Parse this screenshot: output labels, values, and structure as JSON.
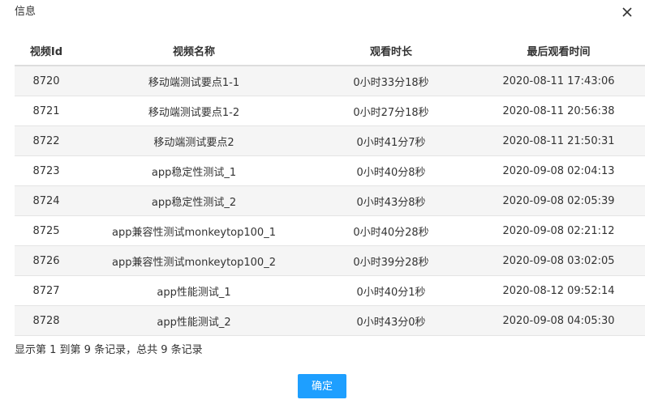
{
  "dialog": {
    "title": "信息",
    "close_icon": "close-icon"
  },
  "table": {
    "headers": {
      "video_id": "视频Id",
      "video_name": "视频名称",
      "watch_duration": "观看时长",
      "last_watch_time": "最后观看时间"
    },
    "rows": [
      {
        "video_id": "8720",
        "video_name": "移动端测试要点1-1",
        "watch_duration": "0小时33分18秒",
        "last_watch_time": "2020-08-11 17:43:06"
      },
      {
        "video_id": "8721",
        "video_name": "移动端测试要点1-2",
        "watch_duration": "0小时27分18秒",
        "last_watch_time": "2020-08-11 20:56:38"
      },
      {
        "video_id": "8722",
        "video_name": "移动端测试要点2",
        "watch_duration": "0小时41分7秒",
        "last_watch_time": "2020-08-11 21:50:31"
      },
      {
        "video_id": "8723",
        "video_name": "app稳定性测试_1",
        "watch_duration": "0小时40分8秒",
        "last_watch_time": "2020-09-08 02:04:13"
      },
      {
        "video_id": "8724",
        "video_name": "app稳定性测试_2",
        "watch_duration": "0小时43分8秒",
        "last_watch_time": "2020-09-08 02:05:39"
      },
      {
        "video_id": "8725",
        "video_name": "app兼容性测试monkeytop100_1",
        "watch_duration": "0小时40分28秒",
        "last_watch_time": "2020-09-08 02:21:12"
      },
      {
        "video_id": "8726",
        "video_name": "app兼容性测试monkeytop100_2",
        "watch_duration": "0小时39分28秒",
        "last_watch_time": "2020-09-08 03:02:05"
      },
      {
        "video_id": "8727",
        "video_name": "app性能测试_1",
        "watch_duration": "0小时40分1秒",
        "last_watch_time": "2020-08-12 09:52:14"
      },
      {
        "video_id": "8728",
        "video_name": "app性能测试_2",
        "watch_duration": "0小时43分0秒",
        "last_watch_time": "2020-09-08 04:05:30"
      }
    ]
  },
  "pagination": {
    "info": "显示第 1 到第 9 条记录，总共 9 条记录"
  },
  "footer": {
    "confirm_label": "确定",
    "confirm_color": "#1e9fff"
  }
}
